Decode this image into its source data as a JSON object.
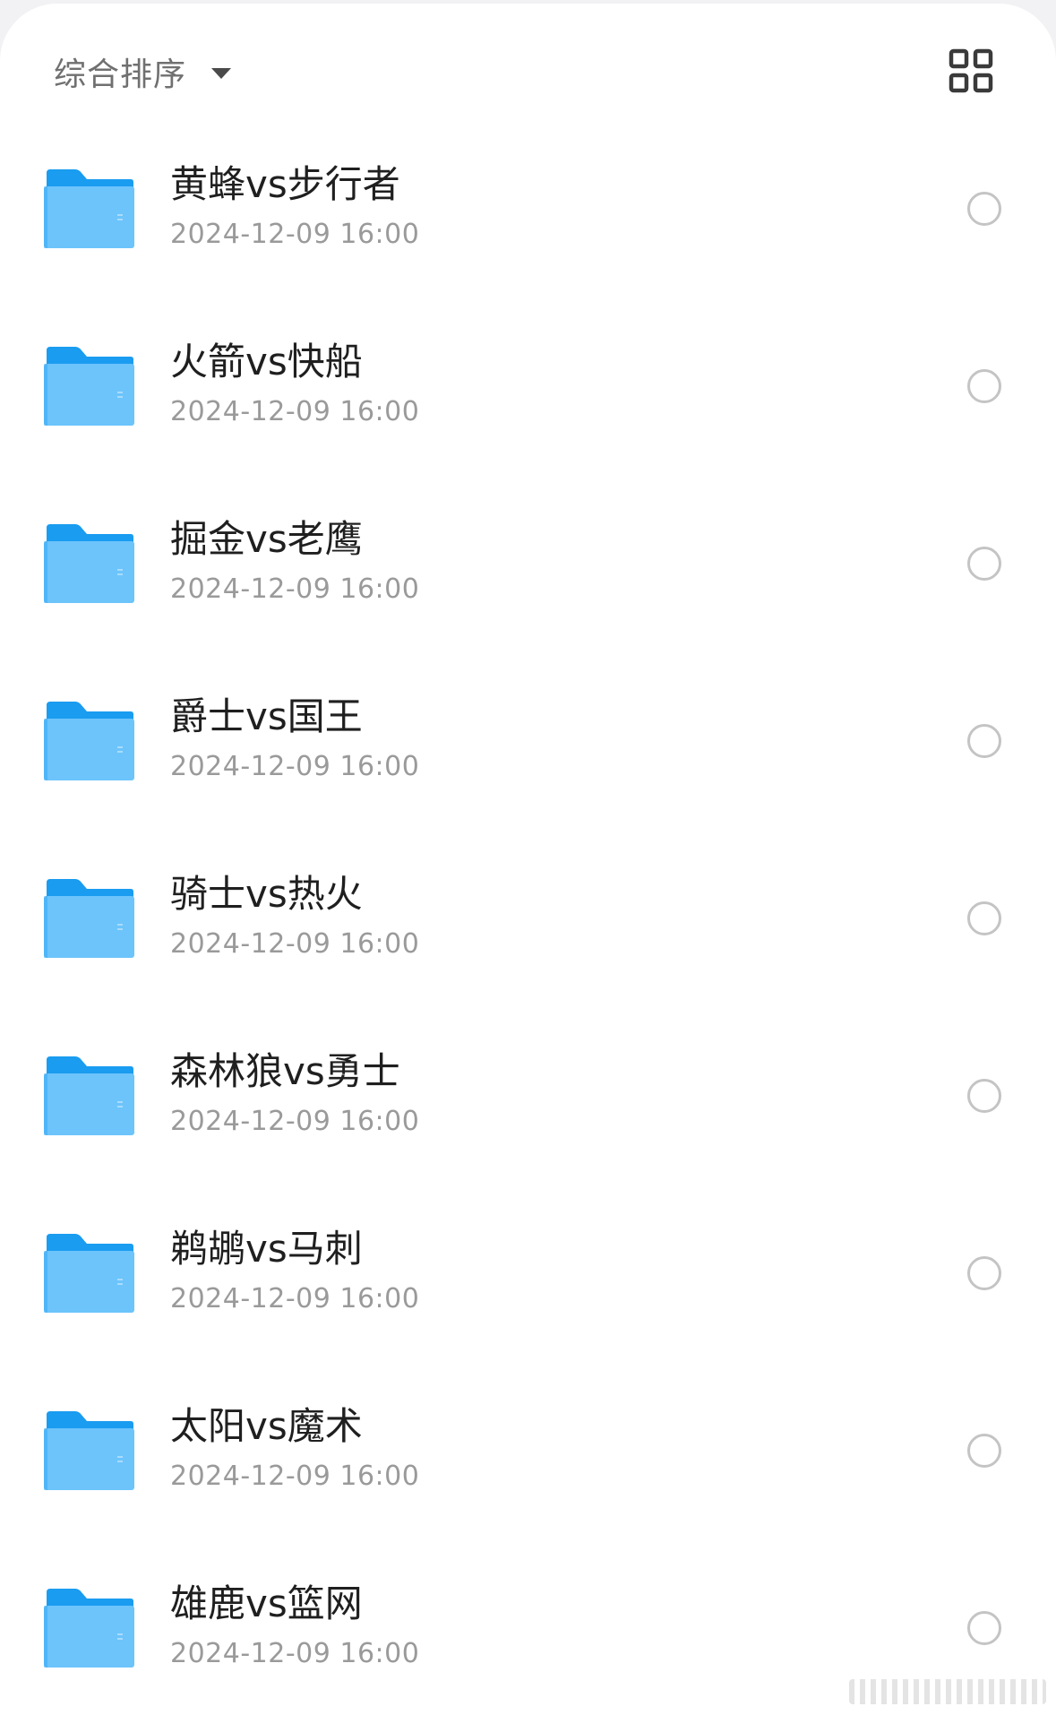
{
  "toolbar": {
    "sort_label": "综合排序",
    "sort_icon": "caret-down-icon",
    "view_icon": "grid-view-icon"
  },
  "colors": {
    "folder_top": "#1a9cf0",
    "folder_body": "#6cc4fb",
    "title_text": "#1f1f1f",
    "date_text": "#9a9a9a"
  },
  "files": [
    {
      "name": "黄蜂vs步行者",
      "date": "2024-12-09 16:00",
      "icon": "folder-icon"
    },
    {
      "name": "火箭vs快船",
      "date": "2024-12-09 16:00",
      "icon": "folder-icon"
    },
    {
      "name": "掘金vs老鹰",
      "date": "2024-12-09 16:00",
      "icon": "folder-icon"
    },
    {
      "name": "爵士vs国王",
      "date": "2024-12-09 16:00",
      "icon": "folder-icon"
    },
    {
      "name": "骑士vs热火",
      "date": "2024-12-09 16:00",
      "icon": "folder-icon"
    },
    {
      "name": "森林狼vs勇士",
      "date": "2024-12-09 16:00",
      "icon": "folder-icon"
    },
    {
      "name": "鹈鹕vs马刺",
      "date": "2024-12-09 16:00",
      "icon": "folder-icon"
    },
    {
      "name": "太阳vs魔术",
      "date": "2024-12-09 16:00",
      "icon": "folder-icon"
    },
    {
      "name": "雄鹿vs篮网",
      "date": "2024-12-09 16:00",
      "icon": "folder-icon"
    }
  ]
}
